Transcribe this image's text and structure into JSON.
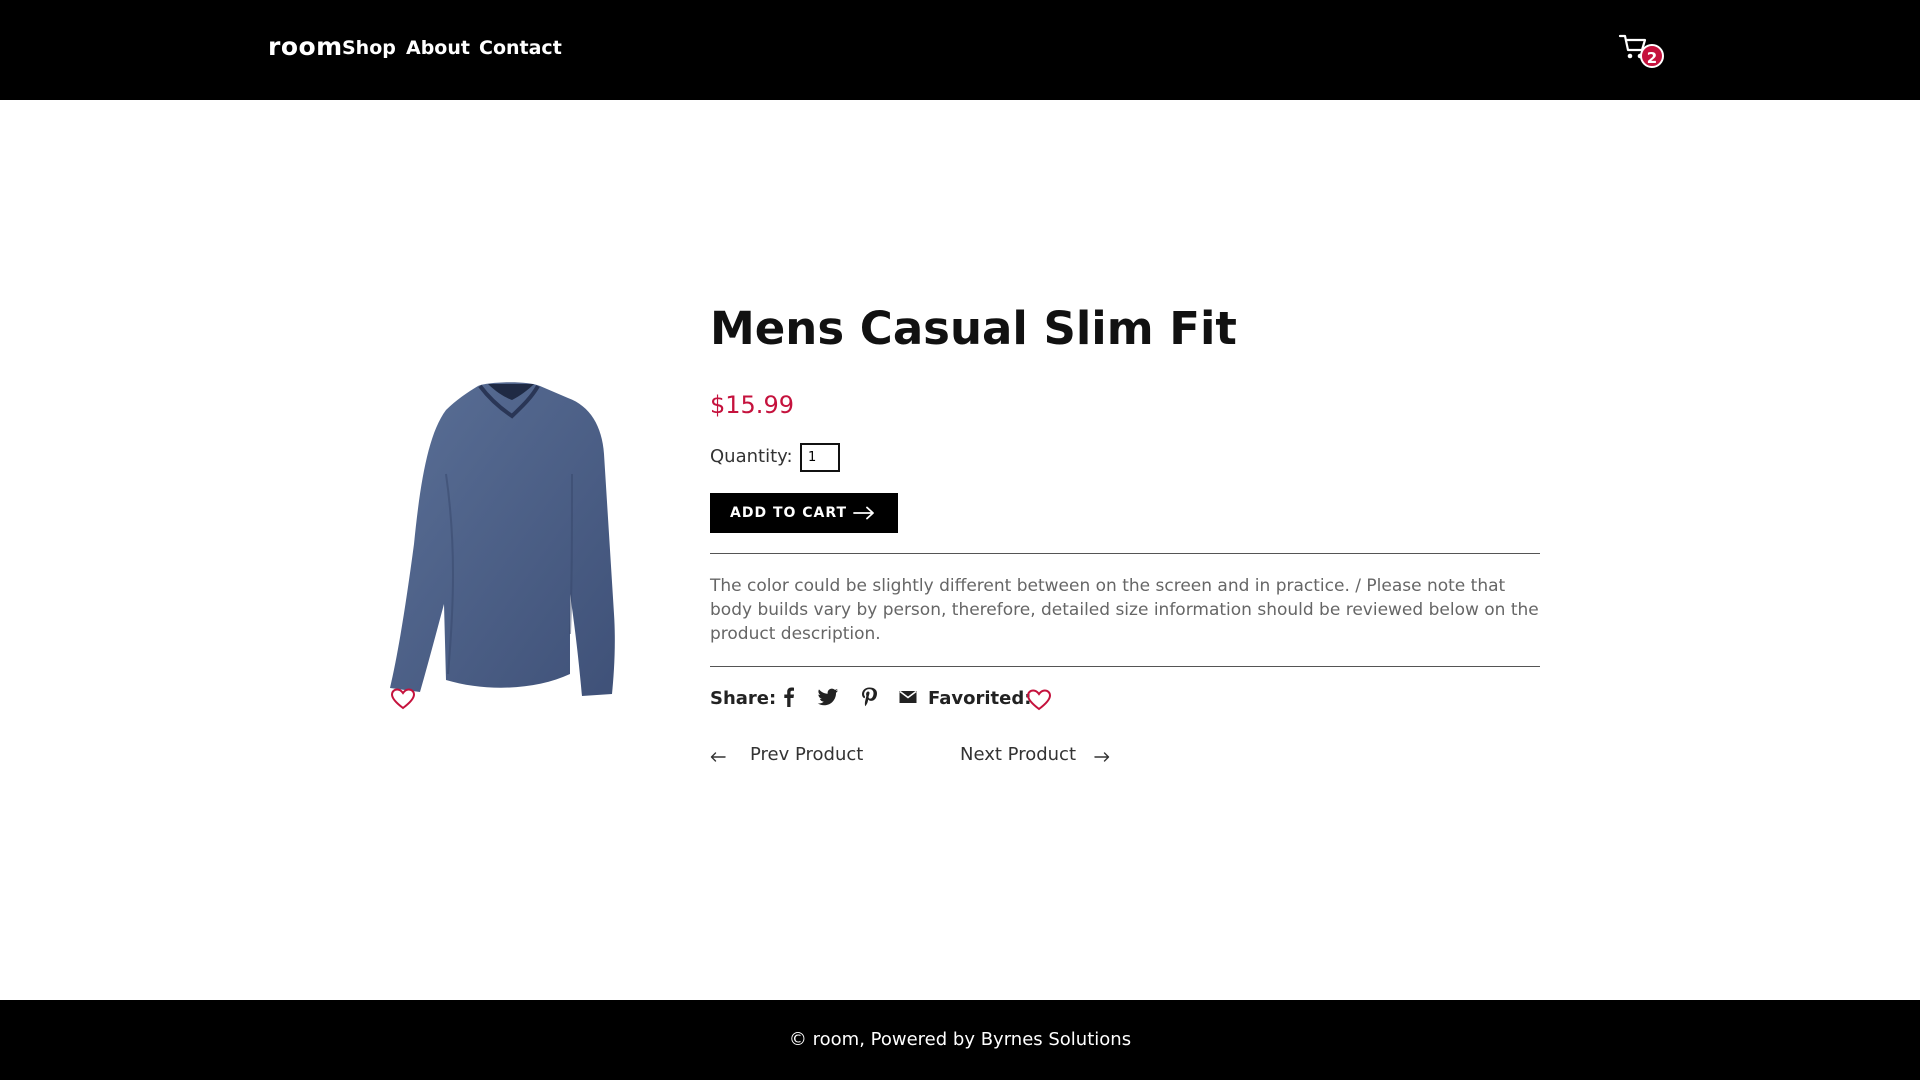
{
  "header": {
    "brand": "room",
    "nav": [
      {
        "label": "Shop"
      },
      {
        "label": "About"
      },
      {
        "label": "Contact"
      }
    ],
    "cart_count": "2"
  },
  "product": {
    "title": "Mens Casual Slim Fit",
    "price": "$15.99",
    "quantity_label": "Quantity:",
    "quantity_value": "1",
    "add_to_cart_label": "ADD TO CART",
    "description": "The color could be slightly different between on the screen and in practice. / Please note that body builds vary by person, therefore, detailed size information should be reviewed below on the product description.",
    "share_label": "Share:",
    "favorited_label": "Favorited:",
    "prev_label": "Prev Product",
    "next_label": "Next Product"
  },
  "footer": {
    "text": "© room, Powered by Byrnes Solutions"
  },
  "colors": {
    "accent": "#c5123d",
    "header_bg": "#000000",
    "shirt": "#4a5f86"
  },
  "icons": [
    "cart-icon",
    "heart-icon",
    "facebook-icon",
    "twitter-icon",
    "pinterest-icon",
    "mail-icon",
    "arrow-right-icon",
    "arrow-left-icon"
  ]
}
